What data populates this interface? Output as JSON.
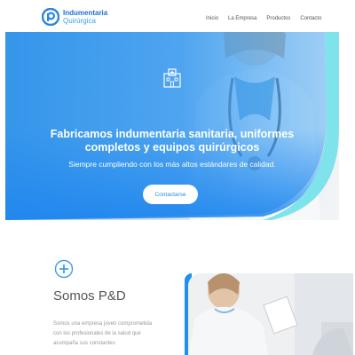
{
  "brand": {
    "line1": "Indumentaria",
    "line2": "Quirúrgica"
  },
  "nav": {
    "items": [
      "Inicio",
      "La Empresa",
      "Productos",
      "Contacto"
    ]
  },
  "hero": {
    "title": "Fabricamos indumentaria sanitaria, uniformes completos y equipos quirúrgicos",
    "subtitle": "Siempre cumpliendo con los más altos estándares de calidad.",
    "cta_label": "Contactarse",
    "icon": "hospital-icon"
  },
  "about": {
    "icon": "plus-circle-icon",
    "title": "Somos P&D",
    "text": "Somos una empresa joven comprometida con los profesionales de la salud que acompaña sus constantes"
  },
  "colors": {
    "accent": "#1e8ff5",
    "brand": "#1d6fd6"
  }
}
